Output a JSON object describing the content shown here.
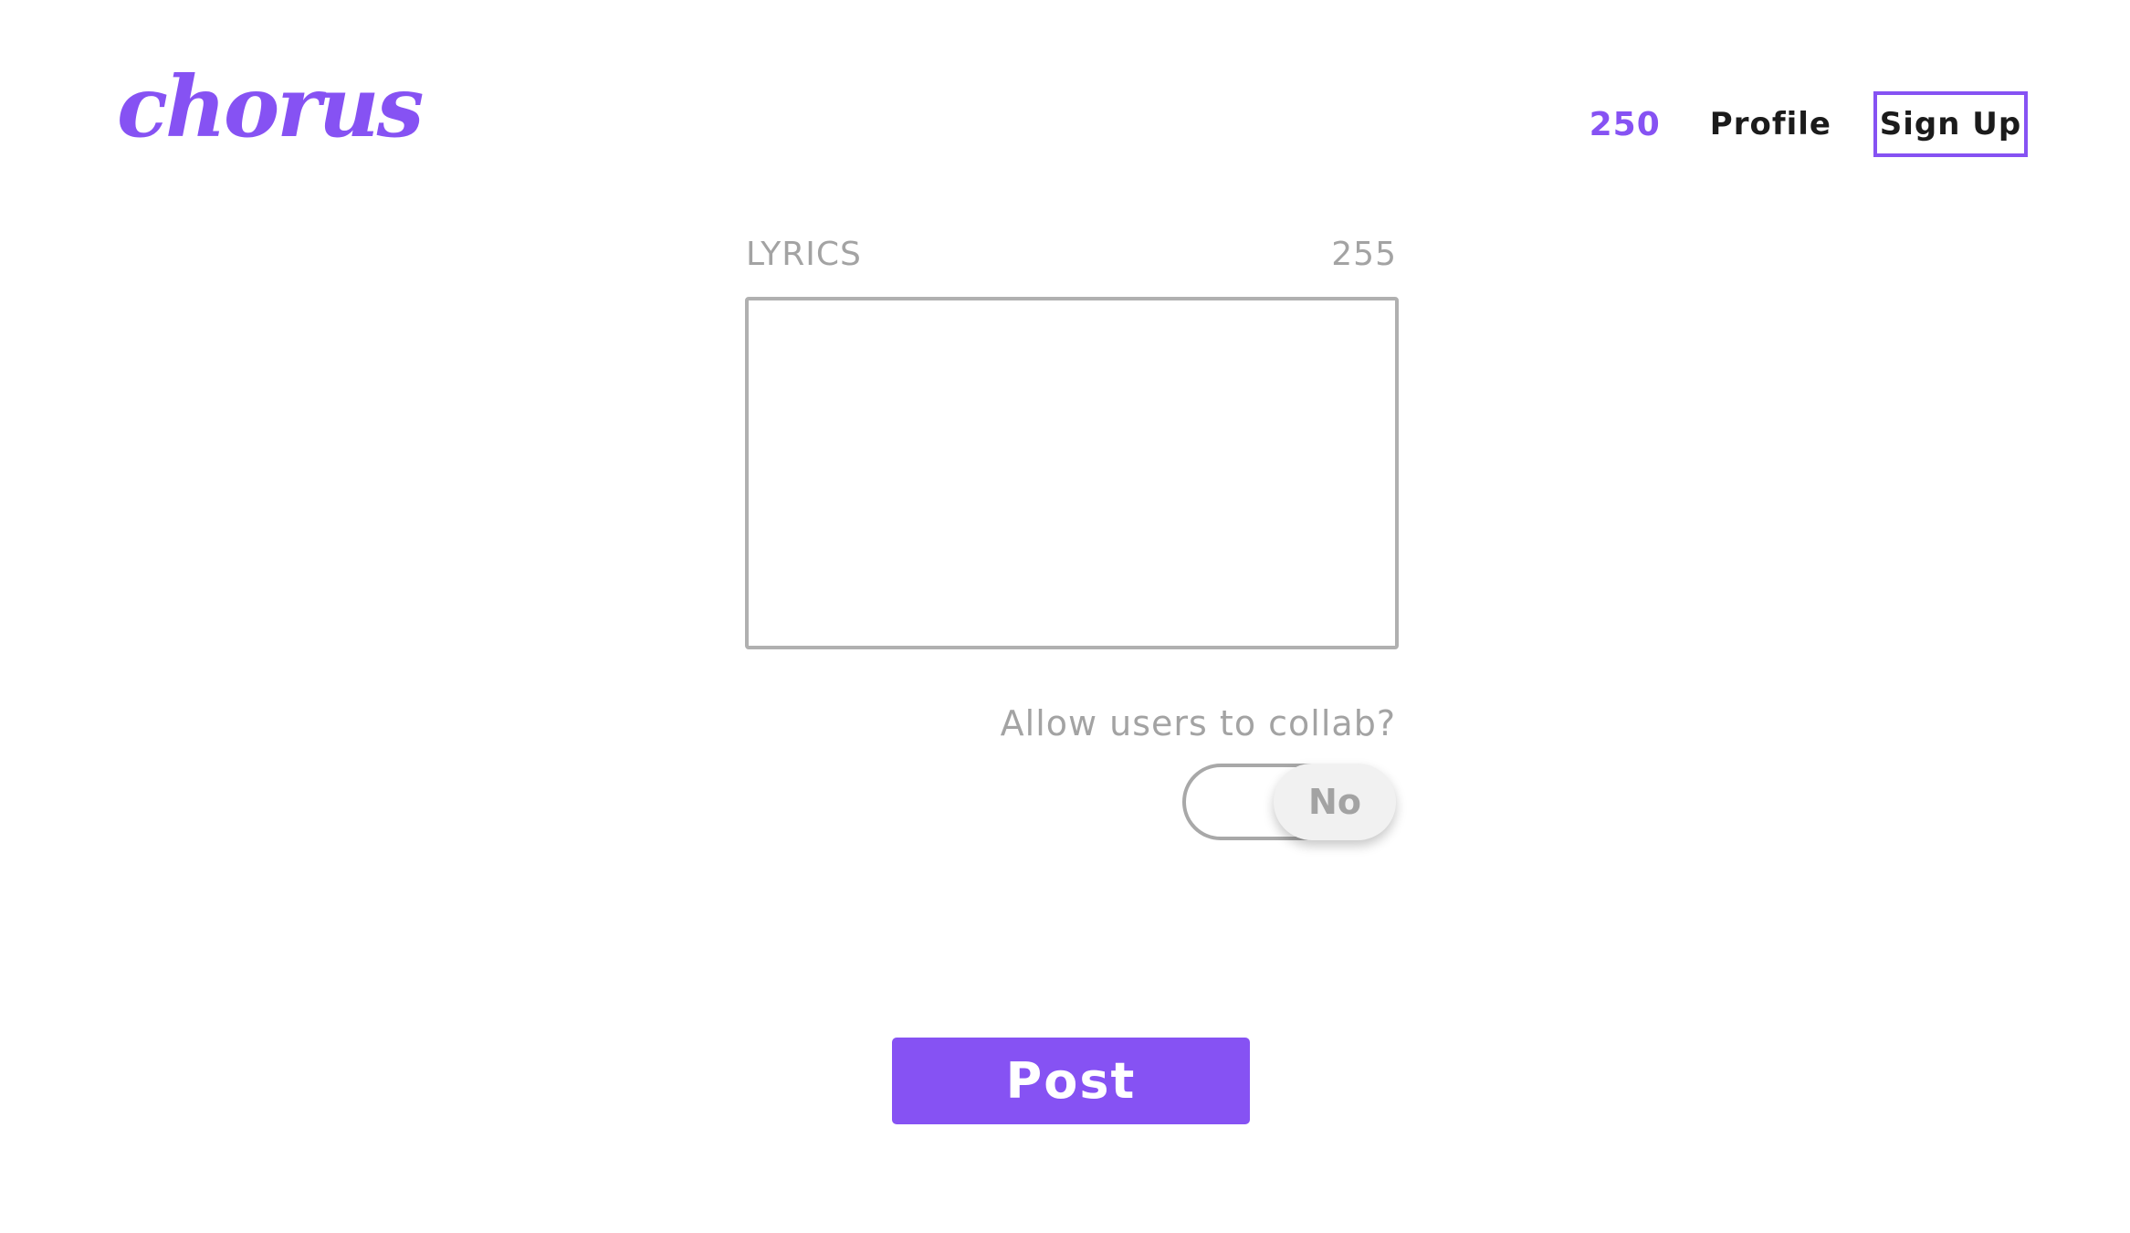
{
  "header": {
    "logo_text": "chorus",
    "points": "250",
    "profile_label": "Profile",
    "signup_label": "Sign Up"
  },
  "lyrics": {
    "label": "LYRICS",
    "char_count": "255",
    "value": ""
  },
  "collab": {
    "question": "Allow users to collab?",
    "toggle_label": "No",
    "enabled": false
  },
  "post_label": "Post",
  "colors": {
    "brand": "#8652f3",
    "muted_text": "#a3a3a3",
    "border": "#b0b0b0"
  }
}
